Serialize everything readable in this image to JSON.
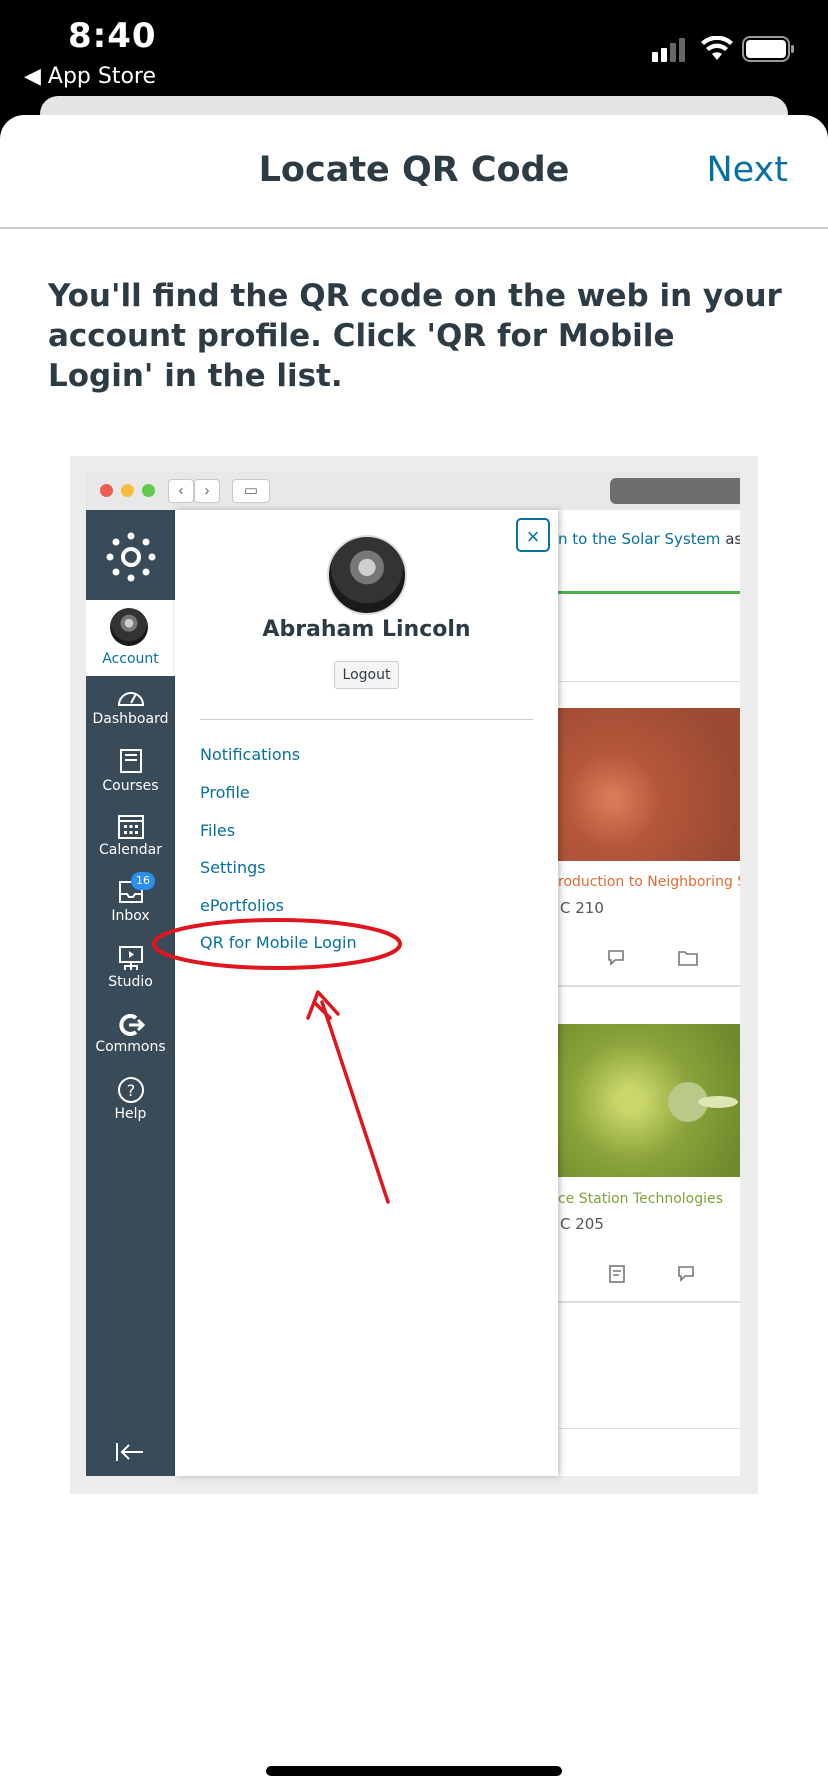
{
  "status_bar": {
    "time": "8:40",
    "back_label": "◀ App Store"
  },
  "nav": {
    "title": "Locate QR Code",
    "next_label": "Next"
  },
  "instructions": "You'll find the QR code on the web in your account profile. Click 'QR for Mobile Login' in the list.",
  "illustration": {
    "sidebar": {
      "account": "Account",
      "items": [
        {
          "label": "Dashboard",
          "icon": "dashboard-icon"
        },
        {
          "label": "Courses",
          "icon": "courses-icon"
        },
        {
          "label": "Calendar",
          "icon": "calendar-icon"
        },
        {
          "label": "Inbox",
          "icon": "inbox-icon",
          "badge": "16"
        },
        {
          "label": "Studio",
          "icon": "studio-icon"
        },
        {
          "label": "Commons",
          "icon": "commons-icon"
        },
        {
          "label": "Help",
          "icon": "help-icon"
        }
      ]
    },
    "tray": {
      "user_name": "Abraham Lincoln",
      "logout_label": "Logout",
      "close_label": "×",
      "links": [
        "Notifications",
        "Profile",
        "Files",
        "Settings",
        "ePortfolios",
        "QR for Mobile Login"
      ]
    },
    "background": {
      "top_link": "n to the Solar System",
      "top_suffix": "as a",
      "card1_title": "roduction to Neighboring Sta",
      "card1_code": "C 210",
      "card2_title": "ce Station Technologies",
      "card2_code": "C 205"
    },
    "colors": {
      "sidebar": "#394b58",
      "link": "#0770a3",
      "highlight": "#e0151d"
    }
  }
}
